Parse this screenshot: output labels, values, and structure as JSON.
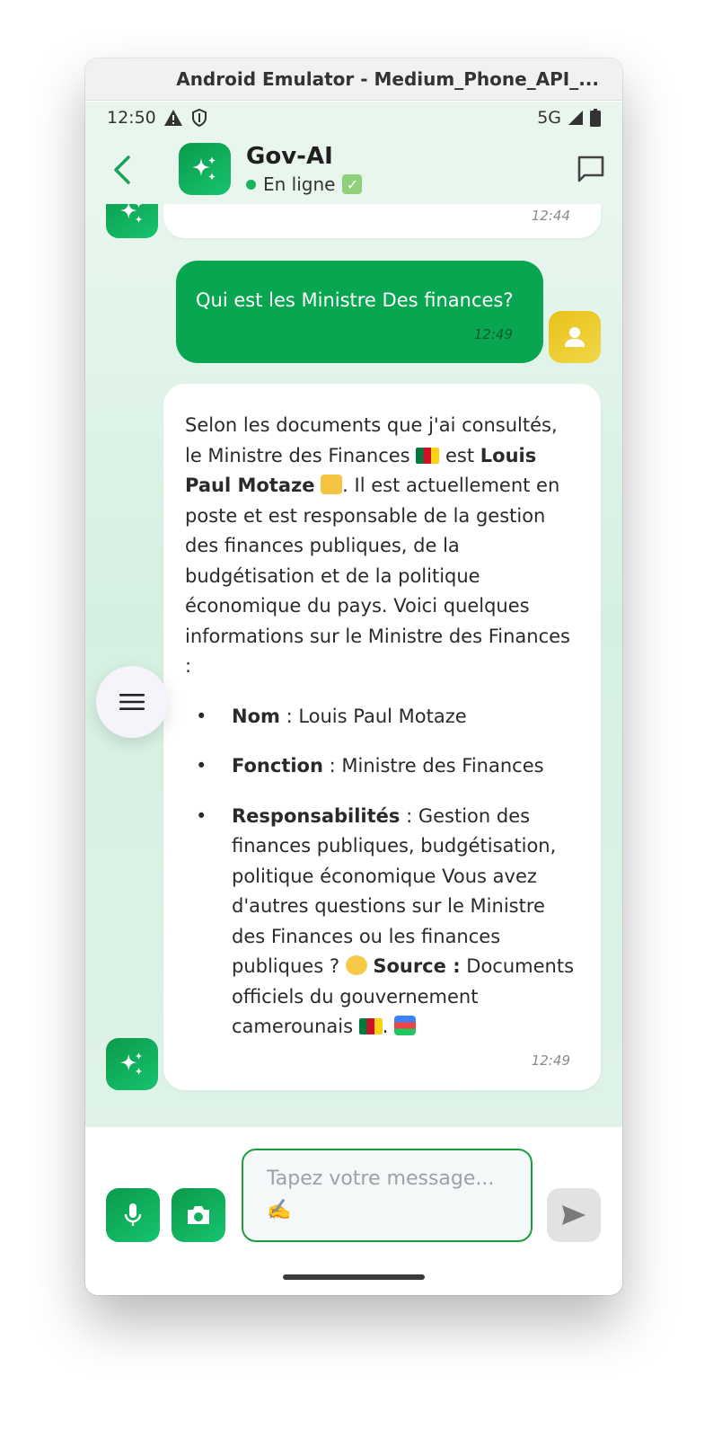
{
  "window": {
    "title": "Android Emulator - Medium_Phone_API_..."
  },
  "status_bar": {
    "time": "12:50",
    "network": "5G"
  },
  "header": {
    "title": "Gov-AI",
    "status": "En ligne",
    "status_emoji": "✅"
  },
  "messages": {
    "prev_bot": {
      "timestamp": "12:44"
    },
    "user": {
      "text": "Qui est les Ministre Des finances?",
      "timestamp": "12:49"
    },
    "bot": {
      "intro_1": "Selon les documents que j'ai consultés, le Ministre des Finances",
      "intro_2": " est ",
      "intro_name": "Louis Paul Motaze",
      "intro_3": ". Il est actuellement en poste et est responsable de la gestion des finances publiques, de la budgétisation et de la politique économique du pays. Voici quelques informations sur le Ministre des Finances :",
      "items": [
        {
          "label": "Nom",
          "value": " : Louis Paul Motaze"
        },
        {
          "label": "Fonction",
          "value": " : Ministre des Finances"
        },
        {
          "label": "Responsabilités",
          "value": " : Gestion des finances publiques, budgétisation, politique économique Vous avez d'autres questions sur le Ministre des Finances ou les finances publiques ? "
        }
      ],
      "source_label": "Source :",
      "source_value": " Documents officiels du gouvernement camerounais",
      "timestamp": "12:49"
    }
  },
  "input": {
    "placeholder": "Tapez votre message... ✍️"
  },
  "colors": {
    "primary_green": "#08a650",
    "user_avatar": "#e8c21a",
    "online": "#19b460"
  },
  "icons": [
    "back-icon",
    "sparkle-icon",
    "chat-icon",
    "menu-icon",
    "person-icon",
    "mic-icon",
    "camera-icon",
    "send-icon",
    "alert-icon",
    "shield-icon",
    "signal-icon",
    "battery-icon"
  ]
}
